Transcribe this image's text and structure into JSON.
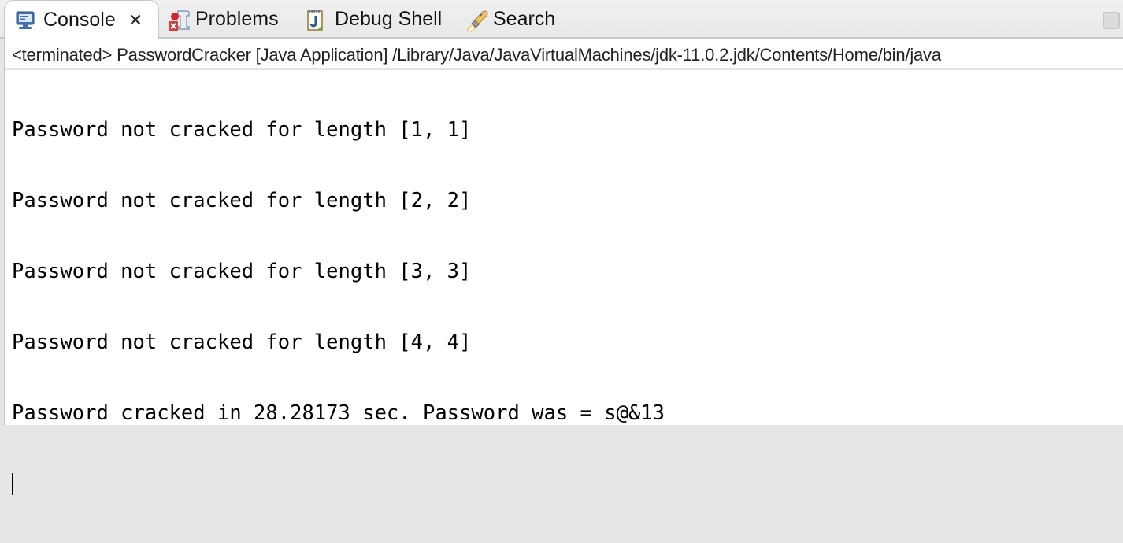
{
  "tabs": [
    {
      "label": "Console",
      "icon": "console-monitor-icon",
      "active": true,
      "closable": true,
      "close_glyph": "✕"
    },
    {
      "label": "Problems",
      "icon": "problems-icon",
      "active": false
    },
    {
      "label": "Debug Shell",
      "icon": "debug-shell-icon",
      "active": false
    },
    {
      "label": "Search",
      "icon": "search-flashlight-icon",
      "active": false
    }
  ],
  "console": {
    "description": "<terminated> PasswordCracker [Java Application] /Library/Java/JavaVirtualMachines/jdk-11.0.2.jdk/Contents/Home/bin/java",
    "lines": [
      "Password not cracked for length [1, 1]",
      "Password not cracked for length [2, 2]",
      "Password not cracked for length [3, 3]",
      "Password not cracked for length [4, 4]",
      "Password cracked in 28.28173 sec. Password was = s@&13"
    ]
  },
  "colors": {
    "tabbar_border": "#c5c8d3",
    "console_text": "#000000",
    "background": "#ffffff"
  }
}
